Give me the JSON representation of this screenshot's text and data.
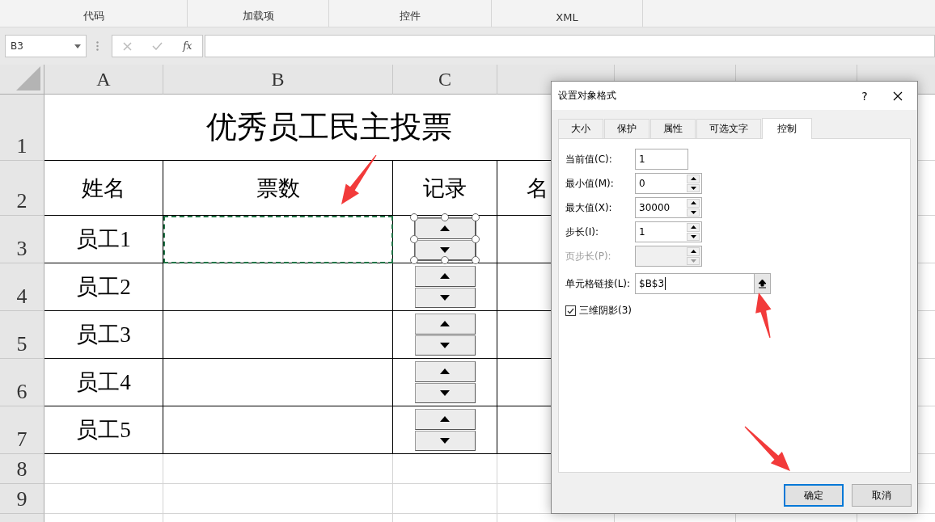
{
  "ribbon": {
    "groups": [
      "代码",
      "加载项",
      "控件",
      "XML"
    ]
  },
  "formula_bar": {
    "name_box": "B3",
    "function_label": "fx"
  },
  "sheet": {
    "columns": [
      "A",
      "B",
      "C"
    ],
    "title_row": {
      "number": "1",
      "title": "优秀员工民主投票"
    },
    "header_row": {
      "number": "2",
      "headers": [
        "姓名",
        "票数",
        "记录",
        "名"
      ]
    },
    "rows": [
      {
        "number": "3",
        "name": "员工1",
        "copy_marquee": true,
        "spinner_selected": true
      },
      {
        "number": "4",
        "name": "员工2",
        "copy_marquee": false,
        "spinner_selected": false
      },
      {
        "number": "5",
        "name": "员工3",
        "copy_marquee": false,
        "spinner_selected": false
      },
      {
        "number": "6",
        "name": "员工4",
        "copy_marquee": false,
        "spinner_selected": false
      },
      {
        "number": "7",
        "name": "员工5",
        "copy_marquee": false,
        "spinner_selected": false
      }
    ],
    "empty_rows": [
      "8",
      "9"
    ]
  },
  "dialog": {
    "title": "设置对象格式",
    "help": "?",
    "tabs": [
      {
        "label": "大小",
        "selected": false
      },
      {
        "label": "保护",
        "selected": false
      },
      {
        "label": "属性",
        "selected": false
      },
      {
        "label": "可选文字",
        "selected": false
      },
      {
        "label": "控制",
        "selected": true
      }
    ],
    "fields": [
      {
        "kind": "text",
        "label": "当前值(C):",
        "value": "1",
        "disabled": false
      },
      {
        "kind": "spin",
        "label": "最小值(M):",
        "value": "0",
        "disabled": false
      },
      {
        "kind": "spin",
        "label": "最大值(X):",
        "value": "30000",
        "disabled": false
      },
      {
        "kind": "spin",
        "label": "步长(I):",
        "value": "1",
        "disabled": false
      },
      {
        "kind": "spin",
        "label": "页步长(P):",
        "disabled": true
      }
    ],
    "cell_link": {
      "label": "单元格链接(L):",
      "value": "$B$3"
    },
    "shading": {
      "label": "三维阴影(3)",
      "checked": true
    },
    "buttons": [
      {
        "label": "确定",
        "default": true
      },
      {
        "label": "取消",
        "default": false
      }
    ]
  }
}
